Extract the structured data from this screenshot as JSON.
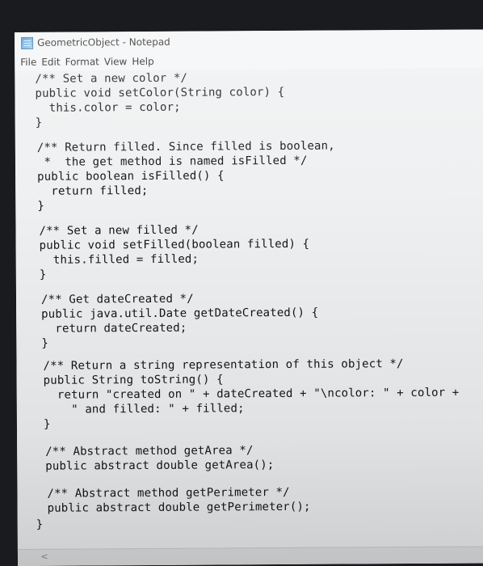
{
  "window": {
    "title": "GeometricObject - Notepad"
  },
  "menu": [
    "File",
    "Edit",
    "Format",
    "View",
    "Help"
  ],
  "code_lines": [
    "/** Set a new color */",
    "public void setColor(String color) {",
    "  this.color = color;",
    "}",
    "/** Return filled. Since filled is boolean,",
    " *  the get method is named isFilled */",
    "public boolean isFilled() {",
    "  return filled;",
    "}",
    "/** Set a new filled */",
    "public void setFilled(boolean filled) {",
    "  this.filled = filled;",
    "}",
    "/** Get dateCreated */",
    "public java.util.Date getDateCreated() {",
    "  return dateCreated;",
    "}",
    "/** Return a string representation of this object */",
    "public String toString() {",
    "  return \"created on \" + dateCreated + \"\\ncolor: \" + color +",
    "    \" and filled: \" + filled;",
    "}",
    "/** Abstract method getArea */",
    "public abstract double getArea();",
    "/** Abstract method getPerimeter */",
    "public abstract double getPerimeter();",
    "}"
  ],
  "scrollbar": {
    "left_arrow": "<"
  }
}
